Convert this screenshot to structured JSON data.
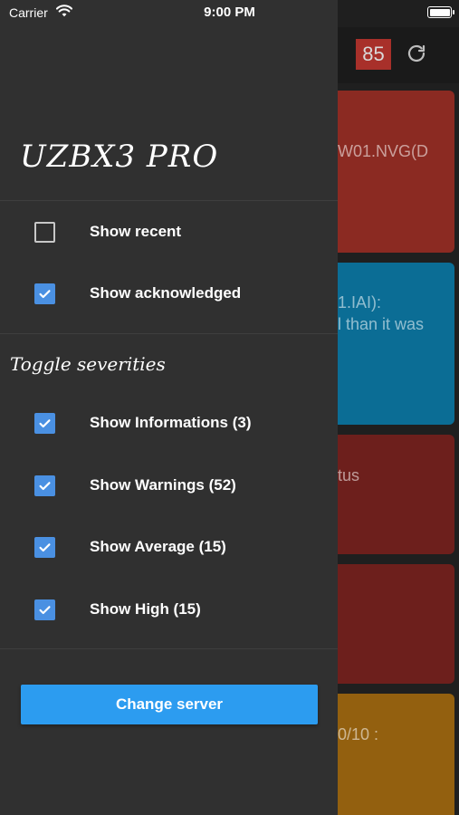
{
  "status_bar": {
    "carrier": "Carrier",
    "time": "9:00 PM",
    "wifi_icon": "wifi-icon",
    "battery_icon": "battery-icon"
  },
  "background": {
    "counter": "85",
    "refresh_icon": "refresh-icon",
    "cards": [
      {
        "color": "#8b2a22",
        "lines": [
          "W01.NVG(D"
        ]
      },
      {
        "color": "#0b6d95",
        "lines": [
          "1.IAI):",
          "l than it was"
        ]
      },
      {
        "color": "#6d1f1c",
        "lines": [
          "tus"
        ]
      },
      {
        "color": "#6d1f1c",
        "lines": []
      },
      {
        "color": "#93600f",
        "lines": [
          "0/10 :"
        ]
      }
    ]
  },
  "drawer": {
    "title": "UZBX3 PRO",
    "view_options": [
      {
        "label": "Show recent",
        "checked": false
      },
      {
        "label": "Show acknowledged",
        "checked": true
      }
    ],
    "severity_section_title": "Toggle severities",
    "severities": [
      {
        "label": "Show Informations (3)",
        "checked": true
      },
      {
        "label": "Show Warnings (52)",
        "checked": true
      },
      {
        "label": "Show Average (15)",
        "checked": true
      },
      {
        "label": "Show High (15)",
        "checked": true
      }
    ],
    "change_server_label": "Change server",
    "accent_color": "#4a90e2",
    "button_color": "#2c9cf0"
  }
}
